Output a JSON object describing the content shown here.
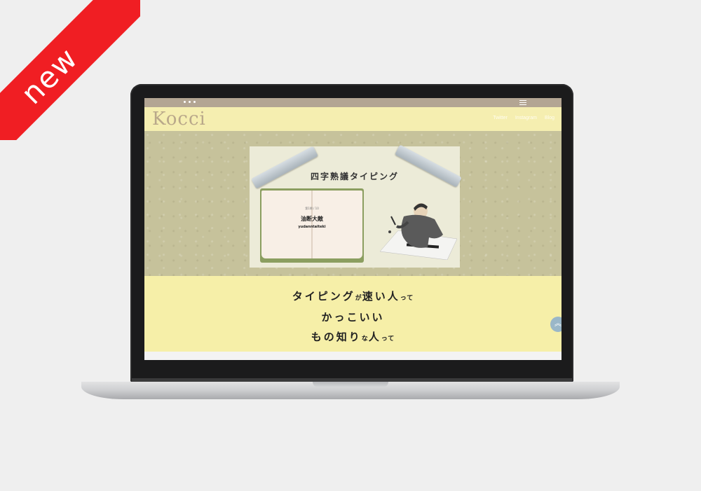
{
  "badge": {
    "label": "new",
    "color": "#f01e23"
  },
  "site": {
    "logo": "Kocci",
    "nav": [
      "Twitter",
      "Instagram",
      "Blog"
    ],
    "hero": {
      "title": "四字熟議タイピング",
      "book": {
        "subtitle": "第1問 / 10",
        "word": "油断大敵",
        "romaji": "yudanntaiteki"
      }
    },
    "slogan": {
      "line1_a": "タイピング",
      "line1_b": "が",
      "line1_c": "速い人",
      "line1_d": "って",
      "line2": "かっこいい",
      "line3_a": "もの知り",
      "line3_b": "な",
      "line3_c": "人",
      "line3_d": "って"
    },
    "scroll_top_icon": "double-chevron-up-icon"
  },
  "colors": {
    "header_bg": "#f5eeb0",
    "hero_bg": "#c6c29b",
    "slogan_bg": "#f6efa8",
    "browser_bar": "#b3a593",
    "scroll_top": "#9ab7c8"
  }
}
